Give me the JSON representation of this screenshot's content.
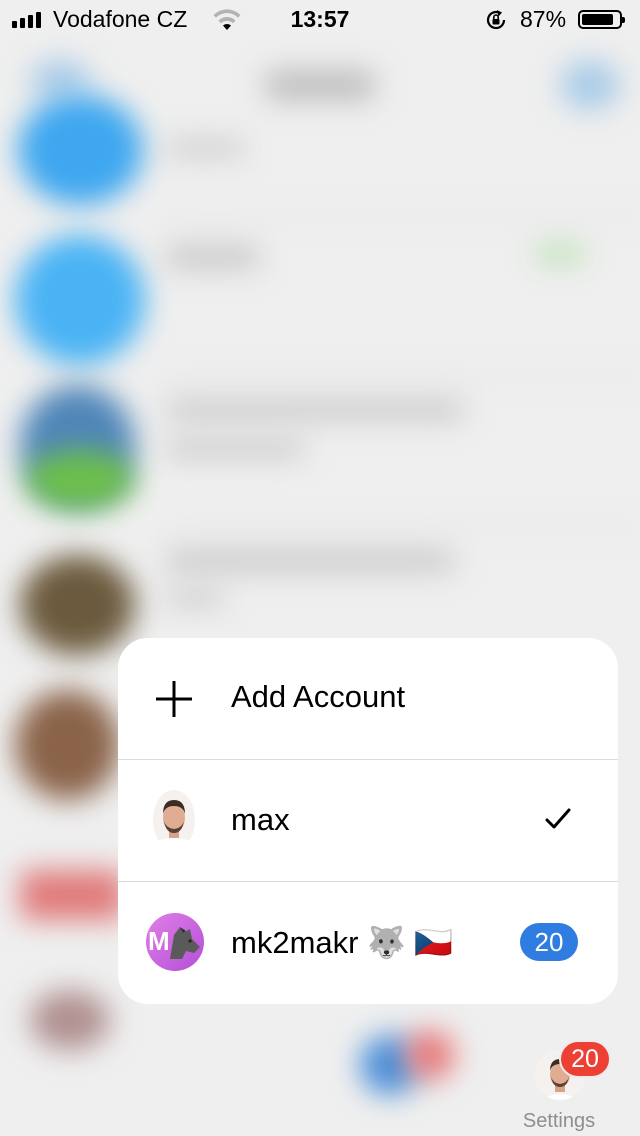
{
  "status_bar": {
    "carrier": "Vodafone CZ",
    "time": "13:57",
    "battery_percent": "87%",
    "battery_level": 0.87,
    "icons": [
      "signal-icon",
      "wifi-icon",
      "rotation-lock-icon",
      "battery-icon"
    ]
  },
  "account_menu": {
    "add_account_label": "Add Account",
    "accounts": [
      {
        "name": "max",
        "selected": true
      },
      {
        "name": "mk2makr 🐺 🇨🇿",
        "unread_count": "20",
        "avatar_letter": "M"
      }
    ]
  },
  "tab_bar": {
    "settings_label": "Settings",
    "settings_badge": "20"
  },
  "colors": {
    "badge_blue": "#2f7de1",
    "badge_red": "#ee3f35",
    "menu_background": "#ffffff",
    "tab_label": "#8e8e93"
  }
}
